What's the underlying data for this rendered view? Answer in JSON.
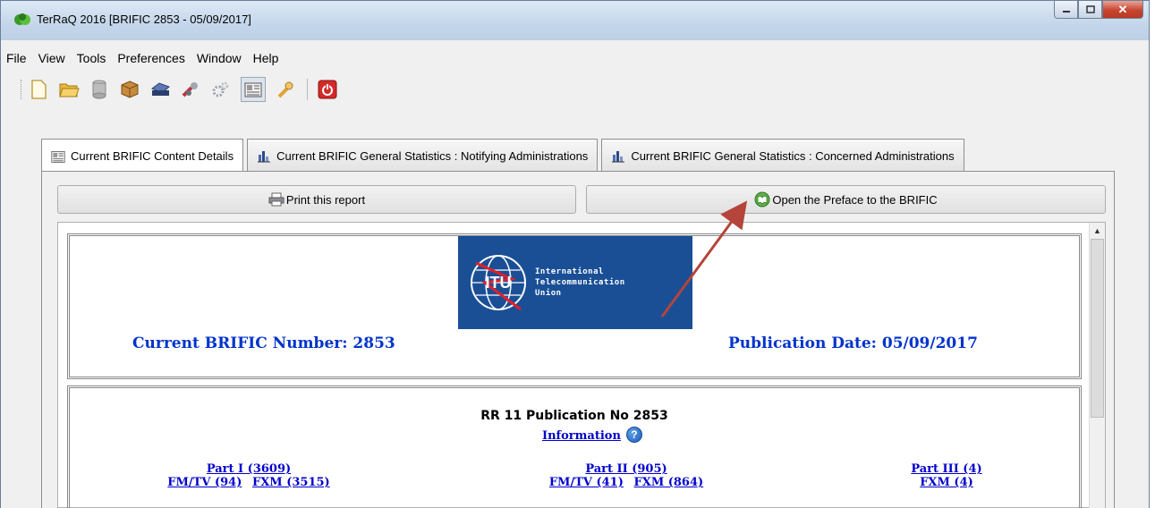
{
  "window": {
    "title": "TerRaQ 2016 [BRIFIC 2853 - 05/09/2017]"
  },
  "menu": [
    "File",
    "View",
    "Tools",
    "Preferences",
    "Window",
    "Help"
  ],
  "toolbar": {
    "icons": [
      "new-document-icon",
      "open-folder-icon",
      "database-icon",
      "package-icon",
      "scanner-icon",
      "tools-icon",
      "gears-icon",
      "brific-icon",
      "wrench-icon",
      "power-icon"
    ]
  },
  "tabs": [
    {
      "label": "Current BRIFIC Content Details",
      "icon": "brific-icon",
      "selected": true
    },
    {
      "label": "Current BRIFIC General Statistics : Notifying Administrations",
      "icon": "statistics-icon",
      "selected": false
    },
    {
      "label": "Current BRIFIC General Statistics : Concerned Administrations",
      "icon": "statistics-icon",
      "selected": false
    }
  ],
  "buttons": {
    "print": "Print this report",
    "preface": "Open the Preface to the BRIFIC"
  },
  "report": {
    "logo_lines": [
      "International",
      "Telecommunication",
      "Union"
    ],
    "logo_abbr": "ITU",
    "brific_number": "Current BRIFIC Number: 2853",
    "publication_date": "Publication Date: 05/09/2017",
    "rr_title": "RR 11 Publication No 2853",
    "information_link": "Information",
    "parts": [
      {
        "title": "Part I (3609)",
        "subs": [
          "FM/TV (94)",
          "FXM (3515)"
        ]
      },
      {
        "title": "Part II (905)",
        "subs": [
          "FM/TV (41)",
          "FXM (864)"
        ]
      },
      {
        "title": "Part III (4)",
        "subs": [
          "FXM (4)"
        ]
      }
    ]
  },
  "colors": {
    "link": "#0000cc",
    "heading_blue": "#0033cc",
    "itu_blue": "#1a4f96",
    "arrow": "#b5443b"
  }
}
